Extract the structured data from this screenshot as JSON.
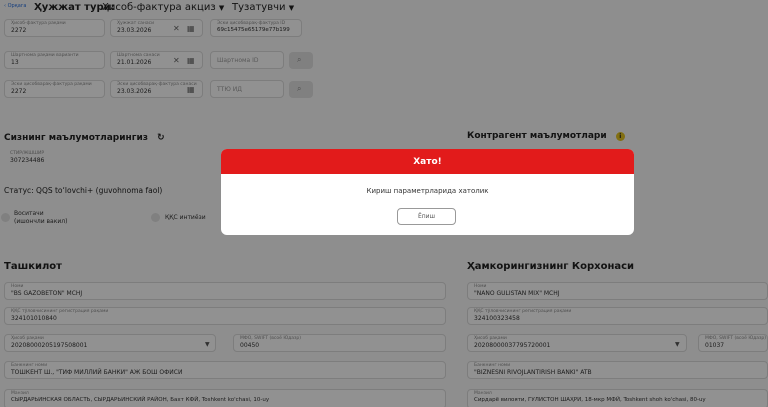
{
  "header": {
    "back_label": "Орқага",
    "doc_type_label": "Ҳужжат тури:",
    "doc_type_value": "Ҳисоб-фактура акциз",
    "sender_label": "Тузатувчи"
  },
  "fields": {
    "sf_number": {
      "label": "Ҳисоб-фактура рақами",
      "value": "2272"
    },
    "sf_date": {
      "label": "Ҳужжат санаси",
      "value": "23.03.2026"
    },
    "cr_id": {
      "label": "Эски ҳисобварақ-фактура ID",
      "value": "69c15475e65179e77b199"
    },
    "contract_number": {
      "label": "Шартнома рақами варианти",
      "value": "13"
    },
    "contract_date": {
      "label": "Шартнома санаси",
      "value": "21.01.2026"
    },
    "contract_id": {
      "placeholder": "Шартнома ID"
    },
    "old_sf_number": {
      "label": "Эски ҳисобварақ-фактура рақами",
      "value": "2272"
    },
    "old_sf_date": {
      "label": "Эски ҳисобварақ-фактура санаси",
      "value": "23.03.2026"
    },
    "tin_id": {
      "placeholder": "ТТЮ ИД"
    }
  },
  "my_info": {
    "title": "Сизнинг маълумотларингиз",
    "tin_label": "СТИР/ЖШШИР",
    "tin_value": "307234486",
    "status": "Статус: QQS to‘lovchi+ (guvohnoma faol)",
    "radio1_line1": "Воситачи",
    "radio1_line2": "(ишончли вакил)",
    "radio2": "ҚҚС интиёзи"
  },
  "counterparty": {
    "title": "Контрагент маълумотлари"
  },
  "org_left": {
    "title": "Ташкилот",
    "name_label": "Номи",
    "name_value": "\"BS GAZOBETON\" MCHJ",
    "vat_label": "ҚҚС тўловчисининг регистрация рақами",
    "vat_value": "324101010840",
    "account_label": "Ҳисоб рақами",
    "account_value": "20208000205197508001",
    "mfo_label": "МФО, SWIFT (всоё Юдазр)",
    "mfo_value": "00450",
    "bank_label": "Банкнинг номи",
    "bank_value": "ТОШКЕНТ Ш., \"ТИФ МИЛЛИЙ БАНКИ\" АЖ БОШ ОФИСИ",
    "address_label": "Манзил",
    "address_value": "СЫРДАРЬИНСКАЯ ОБЛАСТЬ, СЫРДАРЬИНСКИЙ РАЙОН, Бахт КФЙ, Toshkent ko'chasi, 10-uy"
  },
  "org_right": {
    "title": "Ҳамкорингизнинг Корхонаси",
    "name_label": "Номи",
    "name_value": "\"NANO GULISTAN MIX\" MCHJ",
    "vat_label": "ҚҚС тўловчисининг регистрация рақами",
    "vat_value": "324100323458",
    "account_label": "Ҳисоб рақами",
    "account_value": "20208000037795720001",
    "mfo_label": "МФО, SWIFT (всоё Юдазр)",
    "mfo_value": "01037",
    "bank_label": "Банкнинг номи",
    "bank_value": "\"BIZNESNI RIVOJLANTIRISH BANKI\" ATB",
    "address_label": "Манзил",
    "address_value": "Сирдарё вилояти, ГУЛИСТОН ШАҲРИ, 18-мкр МФЙ, Toshkent shoh ko'chasi, 80-uy"
  },
  "modal": {
    "title": "Хато!",
    "message": "Кириш параметрларида хатолик",
    "close_label": "Ёпиш"
  }
}
